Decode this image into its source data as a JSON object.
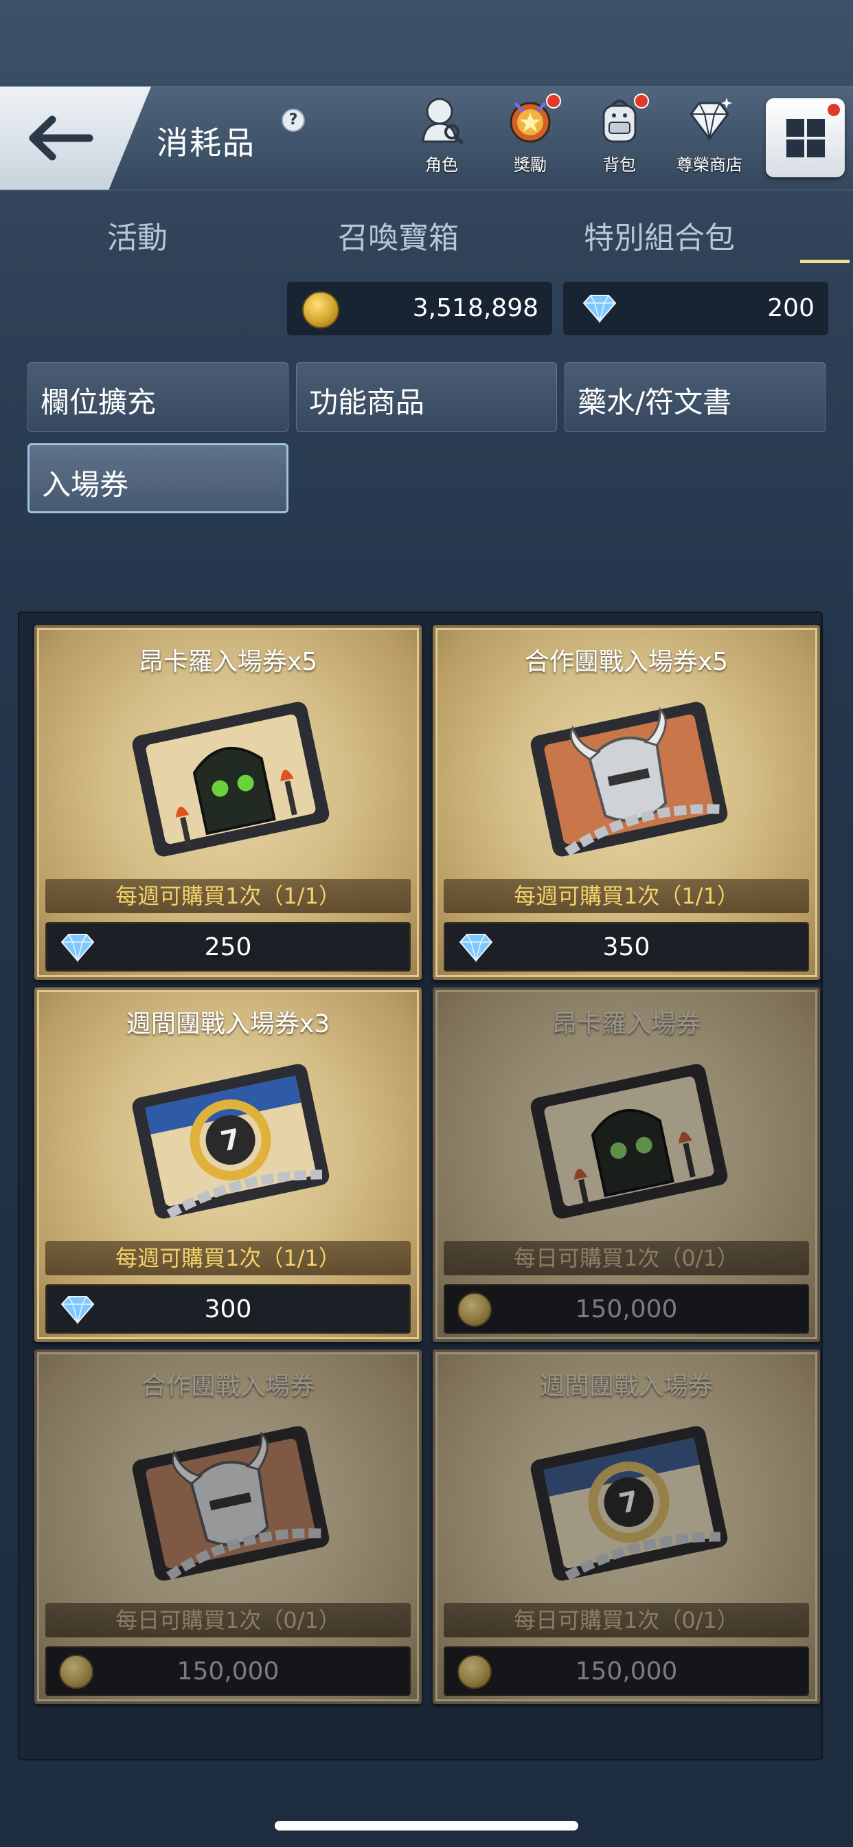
{
  "header": {
    "title": "消耗品",
    "help_symbol": "?",
    "nav": [
      {
        "label": "角色",
        "icon": "character-icon",
        "badge": false
      },
      {
        "label": "獎勵",
        "icon": "reward-icon",
        "badge": true
      },
      {
        "label": "背包",
        "icon": "backpack-icon",
        "badge": true
      },
      {
        "label": "尊榮商店",
        "icon": "diamond-shop-icon",
        "badge": false
      }
    ],
    "menu_badge": true
  },
  "tabs": [
    {
      "label": "活動",
      "active": false
    },
    {
      "label": "召喚寶箱",
      "active": false
    },
    {
      "label": "特別組合包",
      "active": false
    }
  ],
  "currency": {
    "gold": "3,518,898",
    "diamonds": "200"
  },
  "filters": [
    {
      "label": "欄位擴充",
      "selected": false
    },
    {
      "label": "功能商品",
      "selected": false
    },
    {
      "label": "藥水/符文書",
      "selected": false
    },
    {
      "label": "入場券",
      "selected": true
    }
  ],
  "products": [
    {
      "title": "昂卡羅入場券x5",
      "limit": "每週可購買1次（1/1）",
      "currency": "diamond",
      "price": "250",
      "available": true,
      "art": "dungeon-ticket"
    },
    {
      "title": "合作團戰入場券x5",
      "limit": "每週可購買1次（1/1）",
      "currency": "diamond",
      "price": "350",
      "available": true,
      "art": "raid-ticket"
    },
    {
      "title": "週間團戰入場券x3",
      "limit": "每週可購買1次（1/1）",
      "currency": "diamond",
      "price": "300",
      "available": true,
      "art": "weekly-ticket"
    },
    {
      "title": "昂卡羅入場券",
      "limit": "每日可購買1次（0/1）",
      "currency": "gold",
      "price": "150,000",
      "available": false,
      "art": "dungeon-ticket"
    },
    {
      "title": "合作團戰入場券",
      "limit": "每日可購買1次（0/1）",
      "currency": "gold",
      "price": "150,000",
      "available": false,
      "art": "raid-ticket"
    },
    {
      "title": "週間團戰入場券",
      "limit": "每日可購買1次（0/1）",
      "currency": "gold",
      "price": "150,000",
      "available": false,
      "art": "weekly-ticket"
    }
  ],
  "weekly_ticket_number": "7",
  "colors": {
    "accent_gold_text": "#f3d36a",
    "tab_underline": "#f2e08a",
    "badge_red": "#e23a2a"
  }
}
